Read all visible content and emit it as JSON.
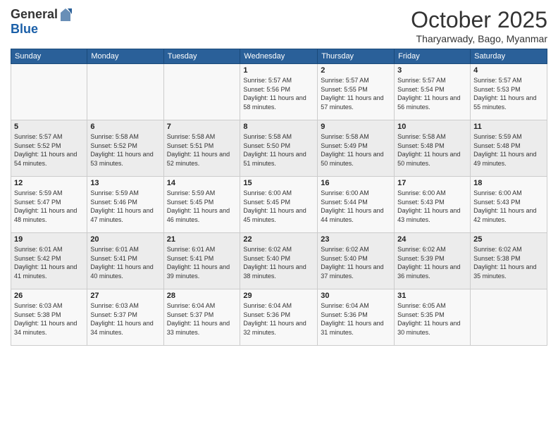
{
  "header": {
    "logo_line1": "General",
    "logo_line2": "Blue",
    "month": "October 2025",
    "location": "Tharyarwady, Bago, Myanmar"
  },
  "weekdays": [
    "Sunday",
    "Monday",
    "Tuesday",
    "Wednesday",
    "Thursday",
    "Friday",
    "Saturday"
  ],
  "weeks": [
    [
      {
        "day": "",
        "info": ""
      },
      {
        "day": "",
        "info": ""
      },
      {
        "day": "",
        "info": ""
      },
      {
        "day": "1",
        "info": "Sunrise: 5:57 AM\nSunset: 5:56 PM\nDaylight: 11 hours\nand 58 minutes."
      },
      {
        "day": "2",
        "info": "Sunrise: 5:57 AM\nSunset: 5:55 PM\nDaylight: 11 hours\nand 57 minutes."
      },
      {
        "day": "3",
        "info": "Sunrise: 5:57 AM\nSunset: 5:54 PM\nDaylight: 11 hours\nand 56 minutes."
      },
      {
        "day": "4",
        "info": "Sunrise: 5:57 AM\nSunset: 5:53 PM\nDaylight: 11 hours\nand 55 minutes."
      }
    ],
    [
      {
        "day": "5",
        "info": "Sunrise: 5:57 AM\nSunset: 5:52 PM\nDaylight: 11 hours\nand 54 minutes."
      },
      {
        "day": "6",
        "info": "Sunrise: 5:58 AM\nSunset: 5:52 PM\nDaylight: 11 hours\nand 53 minutes."
      },
      {
        "day": "7",
        "info": "Sunrise: 5:58 AM\nSunset: 5:51 PM\nDaylight: 11 hours\nand 52 minutes."
      },
      {
        "day": "8",
        "info": "Sunrise: 5:58 AM\nSunset: 5:50 PM\nDaylight: 11 hours\nand 51 minutes."
      },
      {
        "day": "9",
        "info": "Sunrise: 5:58 AM\nSunset: 5:49 PM\nDaylight: 11 hours\nand 50 minutes."
      },
      {
        "day": "10",
        "info": "Sunrise: 5:58 AM\nSunset: 5:48 PM\nDaylight: 11 hours\nand 50 minutes."
      },
      {
        "day": "11",
        "info": "Sunrise: 5:59 AM\nSunset: 5:48 PM\nDaylight: 11 hours\nand 49 minutes."
      }
    ],
    [
      {
        "day": "12",
        "info": "Sunrise: 5:59 AM\nSunset: 5:47 PM\nDaylight: 11 hours\nand 48 minutes."
      },
      {
        "day": "13",
        "info": "Sunrise: 5:59 AM\nSunset: 5:46 PM\nDaylight: 11 hours\nand 47 minutes."
      },
      {
        "day": "14",
        "info": "Sunrise: 5:59 AM\nSunset: 5:45 PM\nDaylight: 11 hours\nand 46 minutes."
      },
      {
        "day": "15",
        "info": "Sunrise: 6:00 AM\nSunset: 5:45 PM\nDaylight: 11 hours\nand 45 minutes."
      },
      {
        "day": "16",
        "info": "Sunrise: 6:00 AM\nSunset: 5:44 PM\nDaylight: 11 hours\nand 44 minutes."
      },
      {
        "day": "17",
        "info": "Sunrise: 6:00 AM\nSunset: 5:43 PM\nDaylight: 11 hours\nand 43 minutes."
      },
      {
        "day": "18",
        "info": "Sunrise: 6:00 AM\nSunset: 5:43 PM\nDaylight: 11 hours\nand 42 minutes."
      }
    ],
    [
      {
        "day": "19",
        "info": "Sunrise: 6:01 AM\nSunset: 5:42 PM\nDaylight: 11 hours\nand 41 minutes."
      },
      {
        "day": "20",
        "info": "Sunrise: 6:01 AM\nSunset: 5:41 PM\nDaylight: 11 hours\nand 40 minutes."
      },
      {
        "day": "21",
        "info": "Sunrise: 6:01 AM\nSunset: 5:41 PM\nDaylight: 11 hours\nand 39 minutes."
      },
      {
        "day": "22",
        "info": "Sunrise: 6:02 AM\nSunset: 5:40 PM\nDaylight: 11 hours\nand 38 minutes."
      },
      {
        "day": "23",
        "info": "Sunrise: 6:02 AM\nSunset: 5:40 PM\nDaylight: 11 hours\nand 37 minutes."
      },
      {
        "day": "24",
        "info": "Sunrise: 6:02 AM\nSunset: 5:39 PM\nDaylight: 11 hours\nand 36 minutes."
      },
      {
        "day": "25",
        "info": "Sunrise: 6:02 AM\nSunset: 5:38 PM\nDaylight: 11 hours\nand 35 minutes."
      }
    ],
    [
      {
        "day": "26",
        "info": "Sunrise: 6:03 AM\nSunset: 5:38 PM\nDaylight: 11 hours\nand 34 minutes."
      },
      {
        "day": "27",
        "info": "Sunrise: 6:03 AM\nSunset: 5:37 PM\nDaylight: 11 hours\nand 34 minutes."
      },
      {
        "day": "28",
        "info": "Sunrise: 6:04 AM\nSunset: 5:37 PM\nDaylight: 11 hours\nand 33 minutes."
      },
      {
        "day": "29",
        "info": "Sunrise: 6:04 AM\nSunset: 5:36 PM\nDaylight: 11 hours\nand 32 minutes."
      },
      {
        "day": "30",
        "info": "Sunrise: 6:04 AM\nSunset: 5:36 PM\nDaylight: 11 hours\nand 31 minutes."
      },
      {
        "day": "31",
        "info": "Sunrise: 6:05 AM\nSunset: 5:35 PM\nDaylight: 11 hours\nand 30 minutes."
      },
      {
        "day": "",
        "info": ""
      }
    ]
  ]
}
